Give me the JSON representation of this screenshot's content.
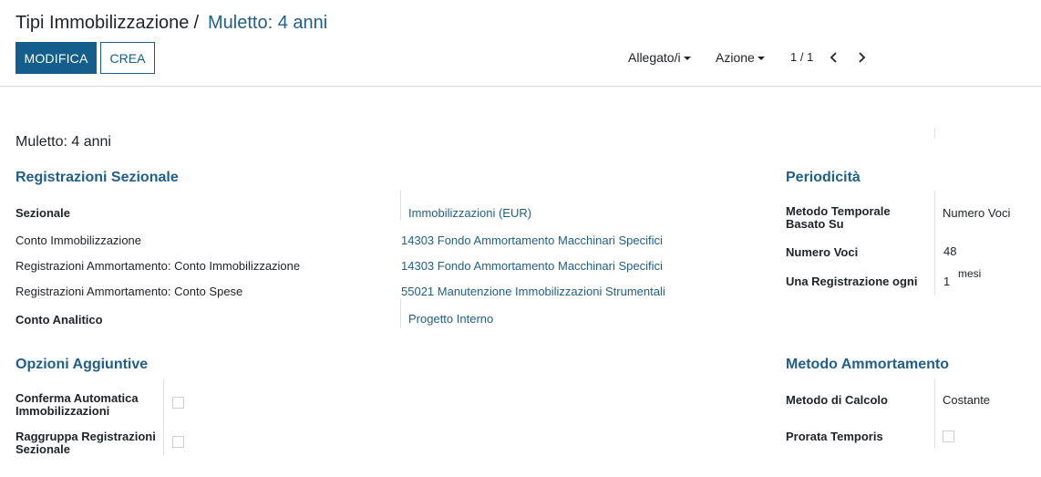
{
  "breadcrumb": {
    "parent": "Tipi Immobilizzazione",
    "separator": "/",
    "current": "Muletto: 4 anni"
  },
  "toolbar": {
    "edit_label": "MODIFICA",
    "create_label": "CREA",
    "attachments_label": "Allegato/i",
    "action_label": "Azione"
  },
  "pager": {
    "value": "1 / 1"
  },
  "form": {
    "title": "Muletto: 4 anni",
    "journal_section": {
      "title": "Registrazioni Sezionale",
      "journal_label": "Sezionale",
      "journal_value": "Immobilizzazioni (EUR)",
      "asset_account_label": "Conto Immobilizzazione",
      "asset_account_value": "14303 Fondo Ammortamento Macchinari Specifici",
      "dep_asset_account_label": "Registrazioni Ammortamento: Conto Immobilizzazione",
      "dep_asset_account_value": "14303 Fondo Ammortamento Macchinari Specifici",
      "dep_expense_account_label": "Registrazioni Ammortamento: Conto Spese",
      "dep_expense_account_value": "55021 Manutenzione Immobilizzazioni Strumentali",
      "analytic_label": "Conto Analitico",
      "analytic_value": "Progetto Interno"
    },
    "periodicity": {
      "title": "Periodicità",
      "time_method_label": "Metodo Temporale Basato Su",
      "time_method_value": "Numero Voci",
      "num_entries_label": "Numero Voci",
      "num_entries_value": "48",
      "one_entry_every_label": "Una Registrazione ogni",
      "one_entry_every_value": "1",
      "one_entry_every_unit": "mesi"
    },
    "additional_options": {
      "title": "Opzioni Aggiuntive",
      "auto_confirm_label": "Conferma Automatica Immobilizzazioni",
      "auto_confirm_checked": false,
      "group_entries_label": "Raggruppa Registrazioni Sezionale",
      "group_entries_checked": false
    },
    "depreciation_method": {
      "title": "Metodo Ammortamento",
      "computation_label": "Metodo di Calcolo",
      "computation_value": "Costante",
      "prorata_label": "Prorata Temporis",
      "prorata_checked": false
    }
  }
}
